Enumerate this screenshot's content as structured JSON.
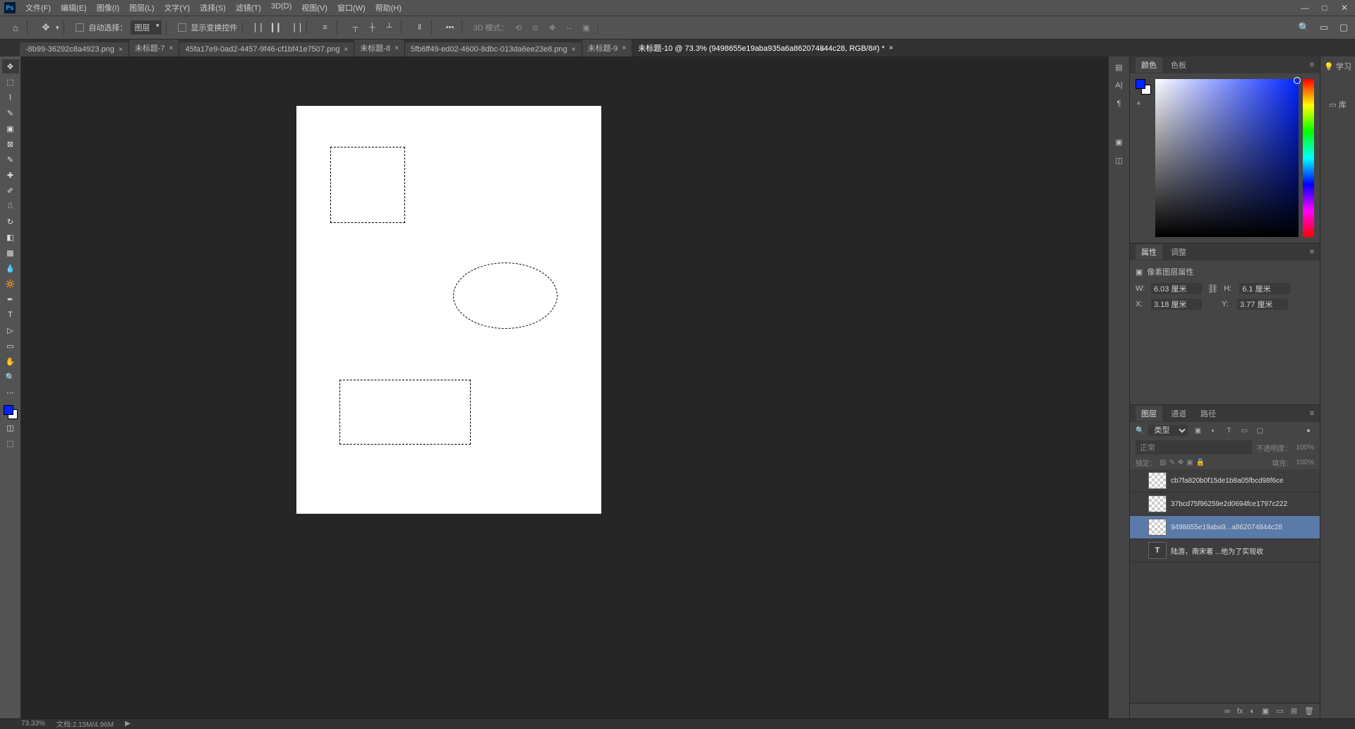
{
  "app": {
    "logo": "Ps"
  },
  "menu": [
    "文件(F)",
    "编辑(E)",
    "图像(I)",
    "图层(L)",
    "文字(Y)",
    "选择(S)",
    "滤镜(T)",
    "3D(D)",
    "视图(V)",
    "窗口(W)",
    "帮助(H)"
  ],
  "winctrl": [
    "—",
    "□",
    "✕"
  ],
  "options": {
    "auto_select_label": "自动选择：",
    "auto_select_target": "图层",
    "show_transform": "显示变换控件",
    "mode3d": "3D 模式："
  },
  "tabs": [
    {
      "label": "-8b99-36292c8a4923.png",
      "close": "×"
    },
    {
      "label": "未标题-7",
      "close": "×"
    },
    {
      "label": "45fa17e9-0ad2-4457-9f46-cf1bf41e7507.png",
      "close": "×"
    },
    {
      "label": "未标题-8",
      "close": "×"
    },
    {
      "label": "5fb6ff49-ed02-4600-8dbc-013da6ee23e8.png",
      "close": "×"
    },
    {
      "label": "未标题-9",
      "close": "×"
    },
    {
      "label": "未标题-10 @ 73.3% (9498655e19aba935a6a862074844c28, RGB/8#) *",
      "close": "×",
      "active": true
    }
  ],
  "tabs_more": "»",
  "panels": {
    "color": {
      "tabs": [
        "颜色",
        "色板"
      ],
      "triangle": "▲"
    },
    "props": {
      "tabs": [
        "属性",
        "调整"
      ],
      "title": "像素图层属性",
      "W": "6.03 厘米",
      "H": "6.1 厘米",
      "X": "3.18 厘米",
      "Y": "3.77 厘米",
      "lblW": "W:",
      "lblH": "H:",
      "lblX": "X:",
      "lblY": "Y:"
    },
    "layers": {
      "tabs": [
        "图层",
        "通道",
        "路径"
      ],
      "filter_kind": "类型",
      "blend": "正常",
      "opacity_lbl": "不透明度：",
      "opacity": "100%",
      "lock_lbl": "锁定：",
      "fill_lbl": "填充：",
      "fill": "100%",
      "items": [
        {
          "name": "cb7fa820b0f15de1b8a05fbcd98f6ce"
        },
        {
          "name": "37bcd75f96259e2d0694fce1797c222"
        },
        {
          "name": "9498655e19aba9...a862074844c28",
          "sel": true
        },
        {
          "name": "陆游，南宋著 ...他为了实现收",
          "type": "T"
        }
      ],
      "foot_icons": [
        "∞",
        "fx",
        "◐",
        "▣",
        "▭",
        "⊞",
        "🗑"
      ]
    }
  },
  "far_right": {
    "learn": "学习",
    "lib": "库"
  },
  "status": {
    "zoom": "73.33%",
    "doc": "文档:2.15M/4.96M",
    "arrow": "▶"
  }
}
